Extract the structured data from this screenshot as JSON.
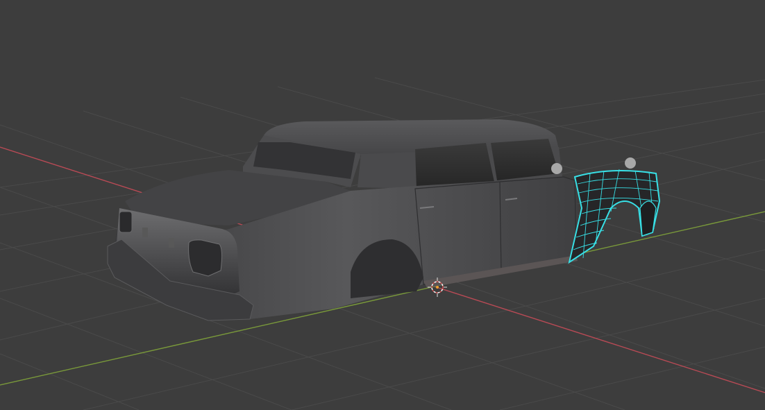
{
  "viewport": {
    "background": "#3d3d3d",
    "grid_color": "#4a4a4a",
    "x_axis_color": "#b84a55",
    "y_axis_color": "#7a9a3a",
    "selection_color": "#38e0e6",
    "cursor_color": "#d05050"
  },
  "scene": {
    "object": "car-body",
    "mode": "edit",
    "selected_part": "front-fender",
    "icons": [
      "3d-cursor-icon",
      "origin-icon"
    ]
  }
}
